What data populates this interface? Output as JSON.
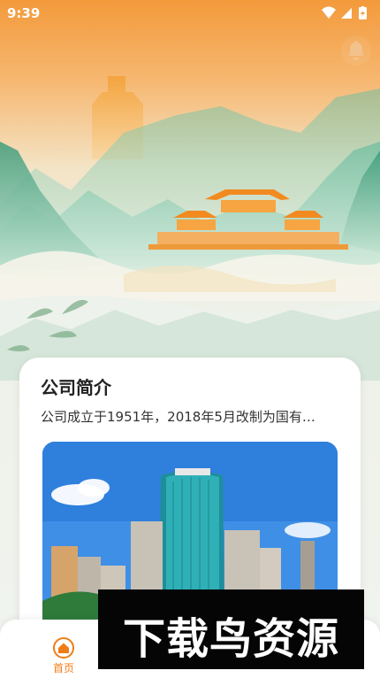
{
  "status_bar": {
    "time": "9:39"
  },
  "header": {
    "bell_icon": "bell-icon"
  },
  "company_intro": {
    "title": "公司简介",
    "description": "公司成立于1951年，2018年5月改制为国有…"
  },
  "bottom_nav": {
    "items": [
      {
        "label": "首页",
        "icon": "home-icon",
        "active": true
      }
    ]
  },
  "watermark": {
    "text": "下载鸟资源"
  },
  "colors": {
    "accent": "#f07c16",
    "header_orange": "#f39a3b"
  }
}
